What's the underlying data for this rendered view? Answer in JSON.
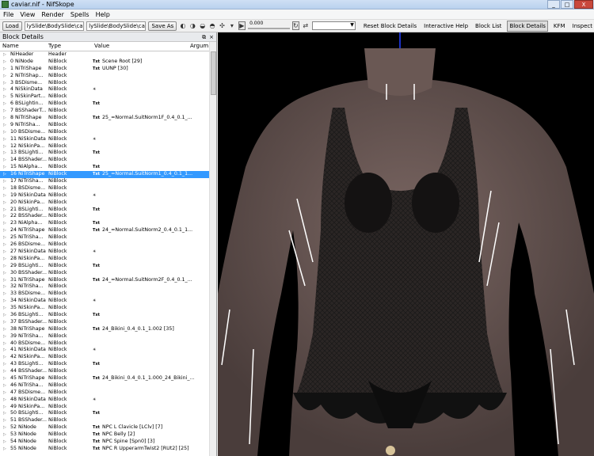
{
  "window": {
    "title": "caviar.nif - NifSkope",
    "buttons": [
      "_",
      "□",
      "X"
    ]
  },
  "menu": [
    "File",
    "View",
    "Render",
    "Spells",
    "Help"
  ],
  "toolbar": {
    "load_label": "Load",
    "path1": "lySlide\\BodySlide\\caviar.nif",
    "path2": "lySlide\\BodySlide\\caviar.nif",
    "saveas_label": "Save As",
    "slider_value": "0.000",
    "links": [
      "Reset Block Details",
      "Interactive Help",
      "Block List",
      "Block Details",
      "KFM",
      "Inspect"
    ]
  },
  "panel": {
    "title": "Block Details",
    "columns": [
      "Name",
      "Type",
      "Value",
      "Argum"
    ],
    "rows": [
      {
        "name": "NiHeader",
        "type": "Header",
        "icon": "",
        "value": ""
      },
      {
        "name": "0 NiNode",
        "type": "NiBlock",
        "icon": "Txt",
        "value": "Scene Root [29]"
      },
      {
        "name": "1 NiTriShape",
        "type": "NiBlock",
        "icon": "Txt",
        "value": "UUNP [30]"
      },
      {
        "name": "2 NiTriShap...",
        "type": "NiBlock",
        "icon": "",
        "value": ""
      },
      {
        "name": "3 BSDisme...",
        "type": "NiBlock",
        "icon": "",
        "value": ""
      },
      {
        "name": "4 NiSkinData",
        "type": "NiBlock",
        "icon": "✳",
        "value": ""
      },
      {
        "name": "5 NiSkinPart...",
        "type": "NiBlock",
        "icon": "",
        "value": ""
      },
      {
        "name": "6 BSLightin...",
        "type": "NiBlock",
        "icon": "Txt",
        "value": ""
      },
      {
        "name": "7 BSShaderT...",
        "type": "NiBlock",
        "icon": "",
        "value": ""
      },
      {
        "name": "8 NiTriShape",
        "type": "NiBlock",
        "icon": "Txt",
        "value": "25_=Normal.SuitNorm1F_0.4_0.1_..."
      },
      {
        "name": "9 NiTriSha...",
        "type": "NiBlock",
        "icon": "",
        "value": ""
      },
      {
        "name": "10 BSDisme...",
        "type": "NiBlock",
        "icon": "",
        "value": ""
      },
      {
        "name": "11 NiSkinData",
        "type": "NiBlock",
        "icon": "✳",
        "value": ""
      },
      {
        "name": "12 NiSkinPa...",
        "type": "NiBlock",
        "icon": "",
        "value": ""
      },
      {
        "name": "13 BSLighti...",
        "type": "NiBlock",
        "icon": "Txt",
        "value": ""
      },
      {
        "name": "14 BSShader...",
        "type": "NiBlock",
        "icon": "",
        "value": ""
      },
      {
        "name": "15 NiAlpha...",
        "type": "NiBlock",
        "icon": "Txt",
        "value": ""
      },
      {
        "name": "16 NiTriShape",
        "type": "NiBlock",
        "icon": "Txt",
        "value": "25_=Normal.SuitNorm1_0.4_0.1_1..."
      },
      {
        "name": "17 NiTriSha...",
        "type": "NiBlock",
        "icon": "",
        "value": ""
      },
      {
        "name": "18 BSDisme...",
        "type": "NiBlock",
        "icon": "",
        "value": ""
      },
      {
        "name": "19 NiSkinData",
        "type": "NiBlock",
        "icon": "✳",
        "value": ""
      },
      {
        "name": "20 NiSkinPa...",
        "type": "NiBlock",
        "icon": "",
        "value": ""
      },
      {
        "name": "21 BSLighti...",
        "type": "NiBlock",
        "icon": "Txt",
        "value": ""
      },
      {
        "name": "22 BSShader...",
        "type": "NiBlock",
        "icon": "",
        "value": ""
      },
      {
        "name": "23 NiAlpha...",
        "type": "NiBlock",
        "icon": "Txt",
        "value": ""
      },
      {
        "name": "24 NiTriShape",
        "type": "NiBlock",
        "icon": "Txt",
        "value": "24_=Normal.SuitNorm2_0.4_0.1_1..."
      },
      {
        "name": "25 NiTriSha...",
        "type": "NiBlock",
        "icon": "",
        "value": ""
      },
      {
        "name": "26 BSDisme...",
        "type": "NiBlock",
        "icon": "",
        "value": ""
      },
      {
        "name": "27 NiSkinData",
        "type": "NiBlock",
        "icon": "✳",
        "value": ""
      },
      {
        "name": "28 NiSkinPa...",
        "type": "NiBlock",
        "icon": "",
        "value": ""
      },
      {
        "name": "29 BSLighti...",
        "type": "NiBlock",
        "icon": "Txt",
        "value": ""
      },
      {
        "name": "30 BSShader...",
        "type": "NiBlock",
        "icon": "",
        "value": ""
      },
      {
        "name": "31 NiTriShape",
        "type": "NiBlock",
        "icon": "Txt",
        "value": "24_=Normal.SuitNorm2F_0.4_0.1_..."
      },
      {
        "name": "32 NiTriSha...",
        "type": "NiBlock",
        "icon": "",
        "value": ""
      },
      {
        "name": "33 BSDisme...",
        "type": "NiBlock",
        "icon": "",
        "value": ""
      },
      {
        "name": "34 NiSkinData",
        "type": "NiBlock",
        "icon": "✳",
        "value": ""
      },
      {
        "name": "35 NiSkinPa...",
        "type": "NiBlock",
        "icon": "",
        "value": ""
      },
      {
        "name": "36 BSLighti...",
        "type": "NiBlock",
        "icon": "Txt",
        "value": ""
      },
      {
        "name": "37 BSShader...",
        "type": "NiBlock",
        "icon": "",
        "value": ""
      },
      {
        "name": "38 NiTriShape",
        "type": "NiBlock",
        "icon": "Txt",
        "value": "24_Bikini_0.4_0.1_1.002 [35]"
      },
      {
        "name": "39 NiTriSha...",
        "type": "NiBlock",
        "icon": "",
        "value": ""
      },
      {
        "name": "40 BSDisme...",
        "type": "NiBlock",
        "icon": "",
        "value": ""
      },
      {
        "name": "41 NiSkinData",
        "type": "NiBlock",
        "icon": "✳",
        "value": ""
      },
      {
        "name": "42 NiSkinPa...",
        "type": "NiBlock",
        "icon": "",
        "value": ""
      },
      {
        "name": "43 BSLighti...",
        "type": "NiBlock",
        "icon": "Txt",
        "value": ""
      },
      {
        "name": "44 BSShader...",
        "type": "NiBlock",
        "icon": "",
        "value": ""
      },
      {
        "name": "45 NiTriShape",
        "type": "NiBlock",
        "icon": "Txt",
        "value": "24_Bikini_0.4_0.1_1.000_24_Bikini_..."
      },
      {
        "name": "46 NiTriSha...",
        "type": "NiBlock",
        "icon": "",
        "value": ""
      },
      {
        "name": "47 BSDisme...",
        "type": "NiBlock",
        "icon": "",
        "value": ""
      },
      {
        "name": "48 NiSkinData",
        "type": "NiBlock",
        "icon": "✳",
        "value": ""
      },
      {
        "name": "49 NiSkinPa...",
        "type": "NiBlock",
        "icon": "",
        "value": ""
      },
      {
        "name": "50 BSLighti...",
        "type": "NiBlock",
        "icon": "Txt",
        "value": ""
      },
      {
        "name": "51 BSShader...",
        "type": "NiBlock",
        "icon": "",
        "value": ""
      },
      {
        "name": "52 NiNode",
        "type": "NiBlock",
        "icon": "Txt",
        "value": "NPC L Clavicle [LClv] [7]"
      },
      {
        "name": "53 NiNode",
        "type": "NiBlock",
        "icon": "Txt",
        "value": "NPC Belly [2]"
      },
      {
        "name": "54 NiNode",
        "type": "NiBlock",
        "icon": "Txt",
        "value": "NPC Spine [Spn0] [3]"
      },
      {
        "name": "55 NiNode",
        "type": "NiBlock",
        "icon": "Txt",
        "value": "NPC R UpperarmTwist2 [RUt2] [25]"
      }
    ]
  }
}
